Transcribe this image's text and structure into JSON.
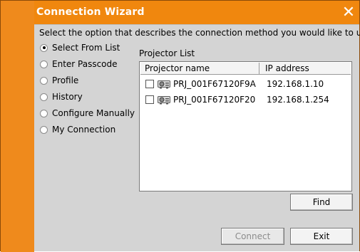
{
  "window": {
    "title": "Connection Wizard",
    "close_label": "✕"
  },
  "prompt": "Select the option that describes the connection method you would like to use:",
  "options": [
    {
      "label": "Select From List",
      "selected": true
    },
    {
      "label": "Enter Passcode",
      "selected": false
    },
    {
      "label": "Profile",
      "selected": false
    },
    {
      "label": "History",
      "selected": false
    },
    {
      "label": "Configure Manually",
      "selected": false
    },
    {
      "label": "My Connection",
      "selected": false
    }
  ],
  "projector_list": {
    "label": "Projector List",
    "columns": [
      "Projector name",
      "IP address"
    ],
    "rows": [
      {
        "name": "PRJ_001F67120F9A",
        "ip": "192.168.1.10",
        "checked": false
      },
      {
        "name": "PRJ_001F67120F20",
        "ip": "192.168.1.254",
        "checked": false
      }
    ]
  },
  "buttons": {
    "find": "Find",
    "connect": "Connect",
    "exit": "Exit"
  },
  "colors": {
    "title_bar": "#f0870e",
    "client": "#d4d4d4"
  }
}
